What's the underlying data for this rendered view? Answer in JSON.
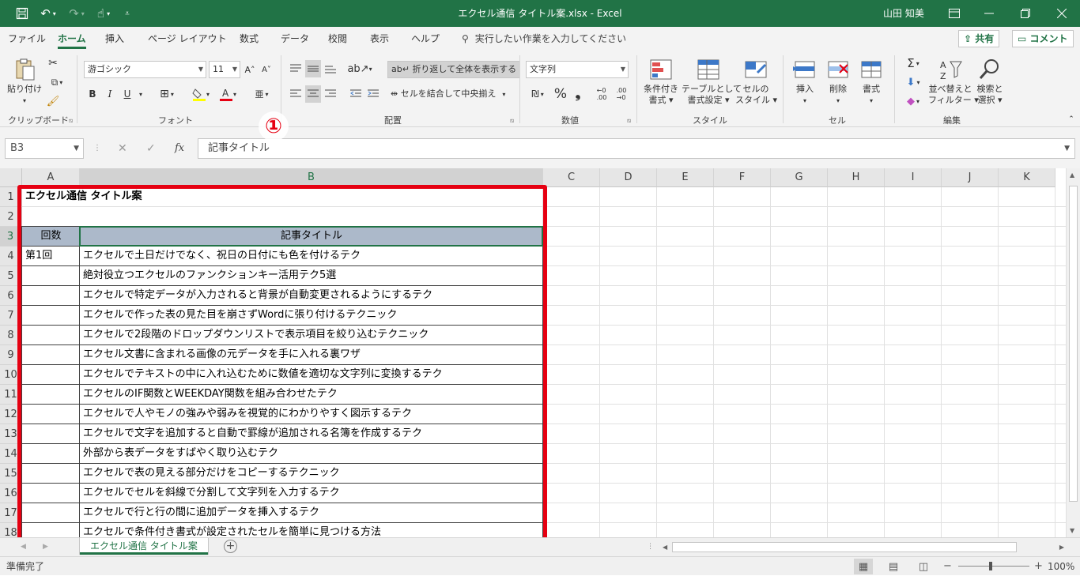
{
  "window": {
    "title": "エクセル通信 タイトル案.xlsx  -  Excel",
    "user": "山田 知美"
  },
  "ribbon_tabs": [
    "ファイル",
    "ホーム",
    "挿入",
    "ページ レイアウト",
    "数式",
    "データ",
    "校閲",
    "表示",
    "ヘルプ"
  ],
  "active_tab": "ホーム",
  "tell_me": "実行したい作業を入力してください",
  "share_label": "共有",
  "comment_label": "コメント",
  "ribbon": {
    "clipboard": {
      "label": "クリップボード",
      "paste": "貼り付け"
    },
    "font": {
      "label": "フォント",
      "name": "游ゴシック",
      "size": "11",
      "bold": "B",
      "italic": "I",
      "underline": "U"
    },
    "alignment": {
      "label": "配置",
      "wrap": "折り返して全体を表示する",
      "merge": "セルを結合して中央揃え"
    },
    "number": {
      "label": "数値",
      "format": "文字列",
      "percent": "%",
      "comma": "❟"
    },
    "styles": {
      "label": "スタイル",
      "cond1": "条件付き",
      "cond2": "書式",
      "table1": "テーブルとして",
      "table2": "書式設定",
      "cell1": "セルの",
      "cell2": "スタイル"
    },
    "cells": {
      "label": "セル",
      "insert": "挿入",
      "delete": "削除",
      "format": "書式"
    },
    "editing": {
      "label": "編集",
      "sort1": "並べ替えと",
      "sort2": "フィルター",
      "find1": "検索と",
      "find2": "選択"
    }
  },
  "formula_bar": {
    "name_box": "B3",
    "formula": "記事タイトル",
    "callout": "①"
  },
  "grid": {
    "columns": [
      "A",
      "B",
      "C",
      "D",
      "E",
      "F",
      "G",
      "H",
      "I",
      "J",
      "K"
    ],
    "selected_column": "B",
    "selected_row": 3,
    "rows": [
      {
        "n": "1",
        "a": "エクセル通信 タイトル案",
        "b": ""
      },
      {
        "n": "2",
        "a": "",
        "b": ""
      },
      {
        "n": "3",
        "a": "回数",
        "b": "記事タイトル"
      },
      {
        "n": "4",
        "a": "第1回",
        "b": "エクセルで土日だけでなく、祝日の日付にも色を付けるテク"
      },
      {
        "n": "5",
        "a": "",
        "b": "絶対役立つエクセルのファンクションキー活用テク5選"
      },
      {
        "n": "6",
        "a": "",
        "b": "エクセルで特定データが入力されると背景が自動変更されるようにするテク"
      },
      {
        "n": "7",
        "a": "",
        "b": "エクセルで作った表の見た目を崩さずWordに張り付けるテクニック"
      },
      {
        "n": "8",
        "a": "",
        "b": "エクセルで2段階のドロップダウンリストで表示項目を絞り込むテクニック"
      },
      {
        "n": "9",
        "a": "",
        "b": "エクセル文書に含まれる画像の元データを手に入れる裏ワザ"
      },
      {
        "n": "10",
        "a": "",
        "b": "エクセルでテキストの中に入れ込むために数値を適切な文字列に変換するテク"
      },
      {
        "n": "11",
        "a": "",
        "b": "エクセルのIF関数とWEEKDAY関数を組み合わせたテク"
      },
      {
        "n": "12",
        "a": "",
        "b": "エクセルで人やモノの強みや弱みを視覚的にわかりやすく図示するテク"
      },
      {
        "n": "13",
        "a": "",
        "b": "エクセルで文字を追加すると自動で罫線が追加される名簿を作成するテク"
      },
      {
        "n": "14",
        "a": "",
        "b": "外部から表データをすばやく取り込むテク"
      },
      {
        "n": "15",
        "a": "",
        "b": "エクセルで表の見える部分だけをコピーするテクニック"
      },
      {
        "n": "16",
        "a": "",
        "b": "エクセルでセルを斜線で分割して文字列を入力するテク"
      },
      {
        "n": "17",
        "a": "",
        "b": "エクセルで行と行の間に追加データを挿入するテク"
      },
      {
        "n": "18",
        "a": "",
        "b": "エクセルで条件付き書式が設定されたセルを簡単に見つける方法"
      }
    ]
  },
  "sheet_tab": "エクセル通信 タイトル案",
  "status": {
    "ready": "準備完了",
    "zoom": "100%"
  },
  "colors": {
    "excel_green": "#217346",
    "header_fill": "#acb9ca",
    "highlight_red": "#e60012"
  }
}
